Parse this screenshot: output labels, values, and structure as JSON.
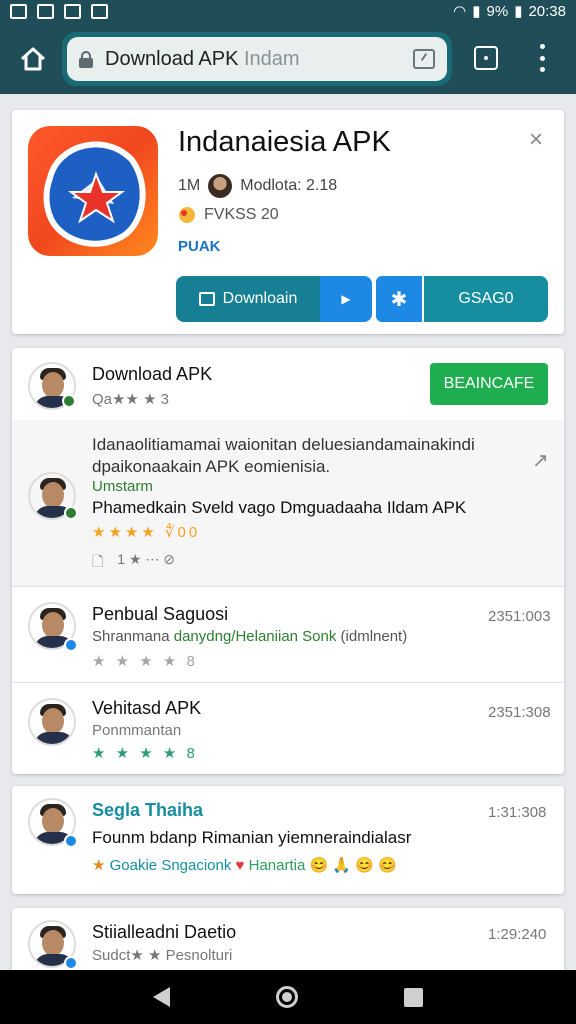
{
  "status_bar": {
    "battery_percent": "9%",
    "time": "20:38"
  },
  "browser": {
    "url_main": "Download APK",
    "url_dim": "Indam"
  },
  "app": {
    "title": "Indanaiesia APK",
    "developer_prefix": "1M",
    "developer": "Modlota: 2.18",
    "meta": "FVKSS 20",
    "label": "PUAK",
    "download_label": "Downloain",
    "extra_label": "GSAG0",
    "accent_color": "#167f93",
    "secondary_color": "#1e88e5"
  },
  "reviews": {
    "top": {
      "name": "Download APK",
      "sub": "Qa★★ ★ 3",
      "button": "BEAINCAFE"
    },
    "highlight": {
      "line1": "Idanaolitiamamai waionitan deluesiandamainakindi",
      "line2": "dpaikonaakain APK eomienisia.",
      "green": "Umstarm",
      "text": "Phamedkain Sveld vago Dmguadaaha Ildam APK",
      "rating_text": "★★★★ ∜00",
      "actions": "1 ★ ⋯ ⊘"
    },
    "items": [
      {
        "name": "Penbual Saguosi",
        "sub_prefix": "Shranmana",
        "sub_green": "danydng/Helaniian Sonk",
        "sub_suffix": "(idmlnent)",
        "date": "2351:003",
        "stars": "★ ★ ★ ★ 8"
      },
      {
        "name": "Vehitasd APK",
        "sub_prefix": "Ponmmantan",
        "sub_green": "",
        "sub_suffix": "",
        "date": "2351:308",
        "stars": "★ ★ ★ ★ 8"
      }
    ]
  },
  "card3": {
    "name": "Segla Thaiha",
    "date": "1:31:308",
    "text": "Founm bdanp Rimanian yiemneraindialasr",
    "tags_prefix": "Goakie Sngacionk",
    "tags_suffix": "Hanartia"
  },
  "card4": {
    "name": "Stiialleadni Daetio",
    "sub": "Sudct★ ★ Pesnolturi",
    "date": "1:29:240"
  }
}
